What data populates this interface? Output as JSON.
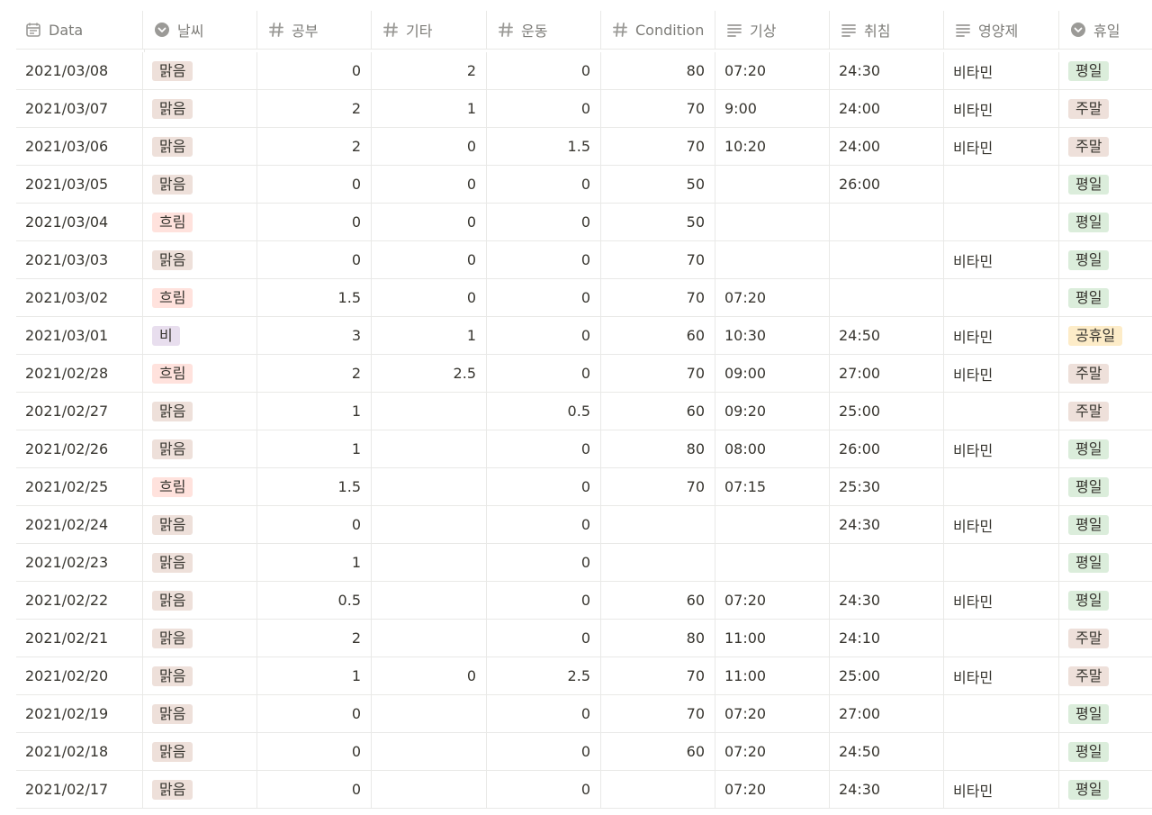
{
  "columns": [
    {
      "label": "Data",
      "icon": "calendar-icon"
    },
    {
      "label": "날씨",
      "icon": "select-icon"
    },
    {
      "label": "공부",
      "icon": "number-icon"
    },
    {
      "label": "기타",
      "icon": "number-icon"
    },
    {
      "label": "운동",
      "icon": "number-icon"
    },
    {
      "label": "Condition",
      "icon": "number-icon"
    },
    {
      "label": "기상",
      "icon": "text-icon"
    },
    {
      "label": "취침",
      "icon": "text-icon"
    },
    {
      "label": "영양제",
      "icon": "text-icon"
    },
    {
      "label": "휴일",
      "icon": "select-icon"
    }
  ],
  "tag_colors": {
    "맑음": "#eee0da",
    "흐림": "#ffe2dd",
    "비": "#e8deee",
    "평일": "#dbeddb",
    "주말": "#eee0da",
    "공휴일": "#fdecc8"
  },
  "rows": [
    {
      "date": "2021/03/08",
      "weather": "맑음",
      "study": "0",
      "etc": "2",
      "exercise": "0",
      "condition": "80",
      "wake": "07:20",
      "sleep": "24:30",
      "supplement": "비타민",
      "holiday": "평일"
    },
    {
      "date": "2021/03/07",
      "weather": "맑음",
      "study": "2",
      "etc": "1",
      "exercise": "0",
      "condition": "70",
      "wake": "9:00",
      "sleep": "24:00",
      "supplement": "비타민",
      "holiday": "주말"
    },
    {
      "date": "2021/03/06",
      "weather": "맑음",
      "study": "2",
      "etc": "0",
      "exercise": "1.5",
      "condition": "70",
      "wake": "10:20",
      "sleep": "24:00",
      "supplement": "비타민",
      "holiday": "주말"
    },
    {
      "date": "2021/03/05",
      "weather": "맑음",
      "study": "0",
      "etc": "0",
      "exercise": "0",
      "condition": "50",
      "wake": "",
      "sleep": "26:00",
      "supplement": "",
      "holiday": "평일"
    },
    {
      "date": "2021/03/04",
      "weather": "흐림",
      "study": "0",
      "etc": "0",
      "exercise": "0",
      "condition": "50",
      "wake": "",
      "sleep": "",
      "supplement": "",
      "holiday": "평일"
    },
    {
      "date": "2021/03/03",
      "weather": "맑음",
      "study": "0",
      "etc": "0",
      "exercise": "0",
      "condition": "70",
      "wake": "",
      "sleep": "",
      "supplement": "비타민",
      "holiday": "평일"
    },
    {
      "date": "2021/03/02",
      "weather": "흐림",
      "study": "1.5",
      "etc": "0",
      "exercise": "0",
      "condition": "70",
      "wake": "07:20",
      "sleep": "",
      "supplement": "",
      "holiday": "평일"
    },
    {
      "date": "2021/03/01",
      "weather": "비",
      "study": "3",
      "etc": "1",
      "exercise": "0",
      "condition": "60",
      "wake": "10:30",
      "sleep": "24:50",
      "supplement": "비타민",
      "holiday": "공휴일"
    },
    {
      "date": "2021/02/28",
      "weather": "흐림",
      "study": "2",
      "etc": "2.5",
      "exercise": "0",
      "condition": "70",
      "wake": "09:00",
      "sleep": "27:00",
      "supplement": "비타민",
      "holiday": "주말"
    },
    {
      "date": "2021/02/27",
      "weather": "맑음",
      "study": "1",
      "etc": "",
      "exercise": "0.5",
      "condition": "60",
      "wake": "09:20",
      "sleep": "25:00",
      "supplement": "",
      "holiday": "주말"
    },
    {
      "date": "2021/02/26",
      "weather": "맑음",
      "study": "1",
      "etc": "",
      "exercise": "0",
      "condition": "80",
      "wake": "08:00",
      "sleep": "26:00",
      "supplement": "비타민",
      "holiday": "평일"
    },
    {
      "date": "2021/02/25",
      "weather": "흐림",
      "study": "1.5",
      "etc": "",
      "exercise": "0",
      "condition": "70",
      "wake": "07:15",
      "sleep": "25:30",
      "supplement": "",
      "holiday": "평일"
    },
    {
      "date": "2021/02/24",
      "weather": "맑음",
      "study": "0",
      "etc": "",
      "exercise": "0",
      "condition": "",
      "wake": "",
      "sleep": "24:30",
      "supplement": "비타민",
      "holiday": "평일"
    },
    {
      "date": "2021/02/23",
      "weather": "맑음",
      "study": "1",
      "etc": "",
      "exercise": "0",
      "condition": "",
      "wake": "",
      "sleep": "",
      "supplement": "",
      "holiday": "평일"
    },
    {
      "date": "2021/02/22",
      "weather": "맑음",
      "study": "0.5",
      "etc": "",
      "exercise": "0",
      "condition": "60",
      "wake": "07:20",
      "sleep": "24:30",
      "supplement": "비타민",
      "holiday": "평일"
    },
    {
      "date": "2021/02/21",
      "weather": "맑음",
      "study": "2",
      "etc": "",
      "exercise": "0",
      "condition": "80",
      "wake": "11:00",
      "sleep": "24:10",
      "supplement": "",
      "holiday": "주말"
    },
    {
      "date": "2021/02/20",
      "weather": "맑음",
      "study": "1",
      "etc": "0",
      "exercise": "2.5",
      "condition": "70",
      "wake": "11:00",
      "sleep": "25:00",
      "supplement": "비타민",
      "holiday": "주말"
    },
    {
      "date": "2021/02/19",
      "weather": "맑음",
      "study": "0",
      "etc": "",
      "exercise": "0",
      "condition": "70",
      "wake": "07:20",
      "sleep": "27:00",
      "supplement": "",
      "holiday": "평일"
    },
    {
      "date": "2021/02/18",
      "weather": "맑음",
      "study": "0",
      "etc": "",
      "exercise": "0",
      "condition": "60",
      "wake": "07:20",
      "sleep": "24:50",
      "supplement": "",
      "holiday": "평일"
    },
    {
      "date": "2021/02/17",
      "weather": "맑음",
      "study": "0",
      "etc": "",
      "exercise": "0",
      "condition": "",
      "wake": "07:20",
      "sleep": "24:30",
      "supplement": "비타민",
      "holiday": "평일"
    }
  ]
}
